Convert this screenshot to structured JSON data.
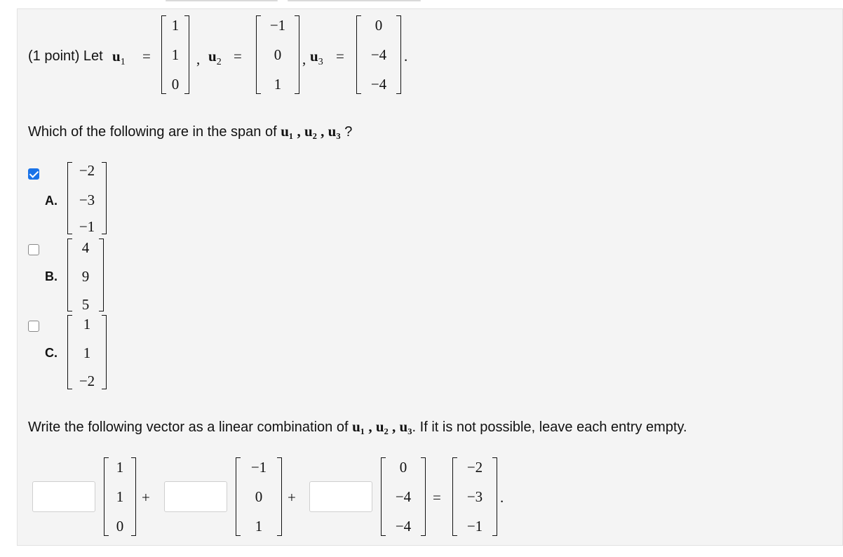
{
  "problem": {
    "prefix": "(1 point) Let",
    "u1_name": "u",
    "u1_sub": "1",
    "u2_name": "u",
    "u2_sub": "2",
    "u3_name": "u",
    "u3_sub": "3",
    "equals": "=",
    "comma": ",",
    "period": ".",
    "u1": [
      "1",
      "1",
      "0"
    ],
    "u2": [
      "−1",
      "0",
      "1"
    ],
    "u3": [
      "0",
      "−4",
      "−4"
    ]
  },
  "question1": {
    "text": "Which of the following are in the span of",
    "vectors": "u₁ , u₂ , u₃",
    "end": " ?"
  },
  "options": [
    {
      "letter": "A.",
      "checked": true,
      "vector": [
        "−2",
        "−3",
        "−1"
      ]
    },
    {
      "letter": "B.",
      "checked": false,
      "vector": [
        "4",
        "9",
        "5"
      ]
    },
    {
      "letter": "C.",
      "checked": false,
      "vector": [
        "1",
        "1",
        "−2"
      ]
    }
  ],
  "question2": {
    "text": "Write the following vector as a linear combination of",
    "vectors": "u₁ , u₂ , u₃",
    "end": ". If it is not possible, leave each entry empty."
  },
  "combination": {
    "plus": "+",
    "equals": "=",
    "period": ".",
    "target": [
      "−2",
      "−3",
      "−1"
    ],
    "coef1_value": "",
    "coef2_value": "",
    "coef3_value": ""
  }
}
